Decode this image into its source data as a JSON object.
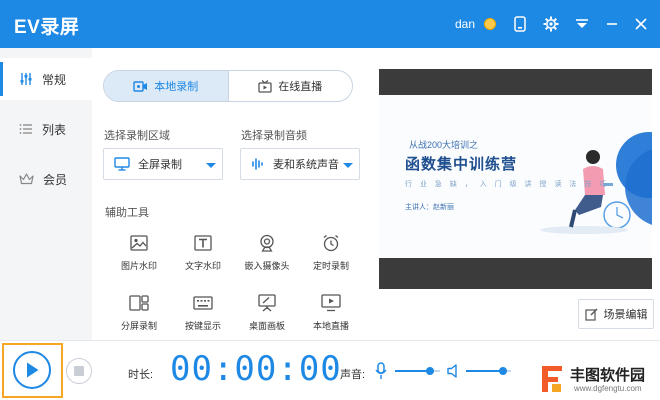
{
  "window": {
    "title": "EV录屏",
    "user": "dan"
  },
  "titlebar_icons": [
    "coin-icon",
    "phone-icon",
    "gear-icon",
    "menu-down-icon",
    "minimize-icon",
    "close-icon"
  ],
  "sidebar": {
    "items": [
      {
        "label": "常规",
        "icon": "sliders-icon",
        "active": true
      },
      {
        "label": "列表",
        "icon": "list-icon",
        "active": false
      },
      {
        "label": "会员",
        "icon": "crown-icon",
        "active": false
      }
    ]
  },
  "mode_tabs": [
    {
      "label": "本地录制",
      "icon": "video-camera-icon",
      "active": true
    },
    {
      "label": "在线直播",
      "icon": "tv-icon",
      "active": false
    }
  ],
  "record_area": {
    "label": "选择录制区域",
    "value": "全屏录制"
  },
  "record_audio": {
    "label": "选择录制音频",
    "value": "麦和系统声音"
  },
  "tools": {
    "label": "辅助工具",
    "items": [
      {
        "label": "图片水印",
        "icon": "image-icon"
      },
      {
        "label": "文字水印",
        "icon": "text-icon"
      },
      {
        "label": "嵌入摄像头",
        "icon": "webcam-icon"
      },
      {
        "label": "定时录制",
        "icon": "alarm-clock-icon"
      },
      {
        "label": "分屏录制",
        "icon": "split-screen-icon"
      },
      {
        "label": "按键显示",
        "icon": "keyboard-icon"
      },
      {
        "label": "桌面画板",
        "icon": "easel-icon"
      },
      {
        "label": "本地直播",
        "icon": "monitor-play-icon"
      }
    ]
  },
  "preview": {
    "line1": "从战200大培训之",
    "title": "函数集中训练营",
    "line3": "行  业  急  缺  ，  入  门  级  讲  授  读  法  技  巧",
    "line4": "主讲人：赵新丽"
  },
  "scene_edit": {
    "label": "场景编辑"
  },
  "bottom": {
    "duration_label": "时长:",
    "timer": "00:00:00",
    "volume_label": "声音:",
    "mic_level": 0.78,
    "speaker_level": 0.82
  },
  "watermark": {
    "brand": "丰图软件园",
    "url": "www.dgfengtu.com"
  },
  "colors": {
    "accent": "#1e88e5",
    "highlight": "#f5a623",
    "preview_bg": "#3b3b3b"
  }
}
